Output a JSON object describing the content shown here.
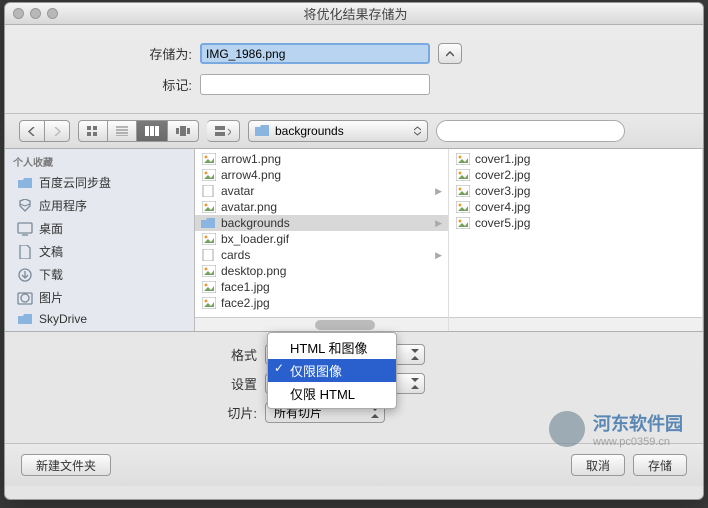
{
  "title": "将优化结果存储为",
  "save_as_label": "存储为:",
  "save_as_value": "IMG_1986.png",
  "tags_label": "标记:",
  "tags_value": "",
  "path_selector": "backgrounds",
  "sidebar": {
    "header": "个人收藏",
    "items": [
      {
        "icon": "folder",
        "label": "百度云同步盘"
      },
      {
        "icon": "app",
        "label": "应用程序"
      },
      {
        "icon": "desktop",
        "label": "桌面"
      },
      {
        "icon": "documents",
        "label": "文稿"
      },
      {
        "icon": "downloads",
        "label": "下载"
      },
      {
        "icon": "pictures",
        "label": "图片"
      },
      {
        "icon": "folder",
        "label": "SkyDrive"
      }
    ]
  },
  "column1": [
    {
      "icon": "img",
      "name": "arrow1.png"
    },
    {
      "icon": "img",
      "name": "arrow4.png"
    },
    {
      "icon": "file",
      "name": "avatar",
      "arrow": true
    },
    {
      "icon": "img",
      "name": "avatar.png"
    },
    {
      "icon": "folder",
      "name": "backgrounds",
      "selected": true,
      "arrow": true
    },
    {
      "icon": "img",
      "name": "bx_loader.gif"
    },
    {
      "icon": "file",
      "name": "cards",
      "arrow": true
    },
    {
      "icon": "img",
      "name": "desktop.png"
    },
    {
      "icon": "img",
      "name": "face1.jpg"
    },
    {
      "icon": "img",
      "name": "face2.jpg"
    }
  ],
  "column2": [
    {
      "icon": "img",
      "name": "cover1.jpg"
    },
    {
      "icon": "img",
      "name": "cover2.jpg"
    },
    {
      "icon": "img",
      "name": "cover3.jpg"
    },
    {
      "icon": "img",
      "name": "cover4.jpg"
    },
    {
      "icon": "img",
      "name": "cover5.jpg"
    }
  ],
  "format_label": "格式",
  "settings_label": "设置",
  "slices_label": "切片:",
  "slices_value": "所有切片",
  "format_menu": {
    "items": [
      "HTML 和图像",
      "仅限图像",
      "仅限 HTML"
    ],
    "selected_index": 1
  },
  "new_folder_btn": "新建文件夹",
  "cancel_btn": "取消",
  "save_btn": "存储",
  "watermark": {
    "name": "河东软件园",
    "url": "www.pc0359.cn"
  }
}
